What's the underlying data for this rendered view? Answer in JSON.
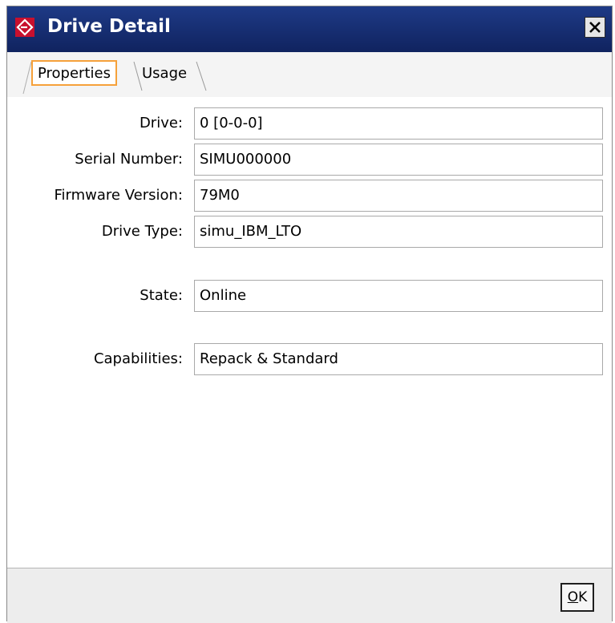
{
  "window": {
    "title": "Drive Detail",
    "icon": "app-logo-icon",
    "close_icon": "close-icon"
  },
  "tabs": [
    {
      "label": "Properties",
      "selected": true
    },
    {
      "label": "Usage",
      "selected": false
    }
  ],
  "fields": [
    {
      "label": "Drive:",
      "value": "0 [0-0-0]"
    },
    {
      "label": "Serial Number:",
      "value": "SIMU000000"
    },
    {
      "label": "Firmware Version:",
      "value": "79M0"
    },
    {
      "label": "Drive Type:",
      "value": "simu_IBM_LTO"
    },
    {
      "label": "State:",
      "value": "Online"
    },
    {
      "label": "Capabilities:",
      "value": "Repack & Standard"
    }
  ],
  "footer": {
    "ok_mnemonic": "O",
    "ok_rest": "K"
  },
  "colors": {
    "titlebar": "#152a6e",
    "tab_focus": "#f6a13a",
    "logo_red": "#c8102e"
  }
}
